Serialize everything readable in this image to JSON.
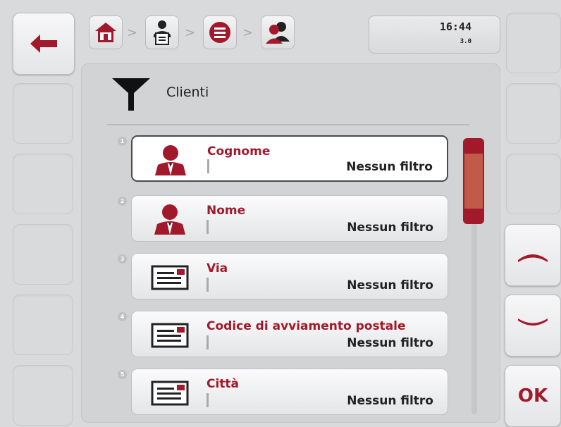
{
  "toolbar": {
    "back_icon": "arrow-left-icon",
    "ok_label": "OK"
  },
  "breadcrumb": {
    "items": [
      {
        "icon": "home-icon"
      },
      {
        "icon": "terminal-user-icon"
      },
      {
        "icon": "menu-list-icon"
      },
      {
        "icon": "customers-icon"
      }
    ],
    "separator": ">"
  },
  "clock": {
    "time": "16:44",
    "version": "3.0"
  },
  "header": {
    "title": "Clienti",
    "icon": "filter-icon"
  },
  "list": {
    "rows": [
      {
        "number": "1",
        "title": "Cognome",
        "value": "Nessun filtro",
        "icon": "person-icon",
        "selected": true
      },
      {
        "number": "2",
        "title": "Nome",
        "value": "Nessun filtro",
        "icon": "person-icon"
      },
      {
        "number": "3",
        "title": "Via",
        "value": "Nessun filtro",
        "icon": "text-field-icon"
      },
      {
        "number": "4",
        "title": "Codice di avviamento postale",
        "value": "Nessun filtro",
        "icon": "text-field-icon"
      },
      {
        "number": "5",
        "title": "Città",
        "value": "Nessun filtro",
        "icon": "text-field-icon"
      }
    ]
  },
  "colors": {
    "accent": "#a2192b",
    "scroll_thumb": "#c25a4a"
  }
}
